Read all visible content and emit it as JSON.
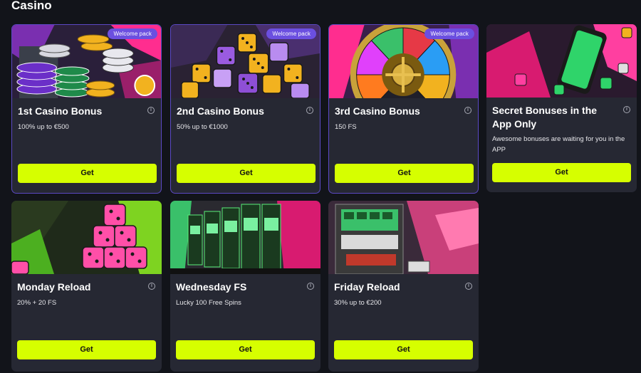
{
  "section": {
    "title": "Casino"
  },
  "cards": [
    {
      "title": "1st Casino Bonus",
      "description": "100% up to €500",
      "badge": "Welcome pack",
      "button": "Get",
      "info": "i"
    },
    {
      "title": "2nd Casino Bonus",
      "description": "50% up to €1000",
      "badge": "Welcome pack",
      "button": "Get",
      "info": "i"
    },
    {
      "title": "3rd Casino Bonus",
      "description": "150 FS",
      "badge": "Welcome pack",
      "button": "Get",
      "info": "i"
    },
    {
      "title": "Secret Bonuses in the App Only",
      "description": "Awesome bonuses are waiting for you in the APP",
      "button": "Get",
      "info": "i"
    },
    {
      "title": "Monday Reload",
      "description": "20% + 20 FS",
      "button": "Get",
      "info": "i"
    },
    {
      "title": "Wednesday FS",
      "description": "Lucky 100 Free Spins",
      "button": "Get",
      "info": "i"
    },
    {
      "title": "Friday Reload",
      "description": "30% up to €200",
      "button": "Get",
      "info": "i"
    }
  ],
  "colors": {
    "accent": "#d6ff00",
    "badge": "#6b4fe0",
    "card": "#262833",
    "background": "#12141a"
  }
}
